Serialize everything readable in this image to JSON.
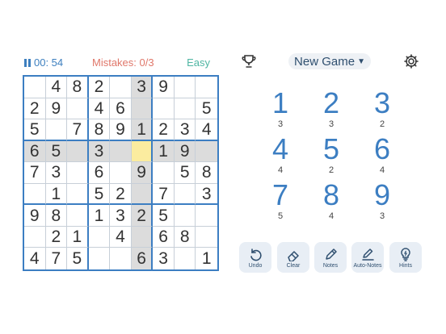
{
  "status": {
    "timer": "00: 54",
    "mistakes": "Mistakes: 0/3",
    "difficulty": "Easy"
  },
  "header": {
    "new_game_label": "New Game"
  },
  "board": {
    "rows": [
      [
        "",
        "4",
        "8",
        "2",
        "",
        "3",
        "9",
        "",
        ""
      ],
      [
        "2",
        "9",
        "",
        "4",
        "6",
        "",
        "",
        "",
        "5"
      ],
      [
        "5",
        "",
        "7",
        "8",
        "9",
        "1",
        "2",
        "3",
        "4"
      ],
      [
        "6",
        "5",
        "",
        "3",
        "",
        "",
        "1",
        "9",
        ""
      ],
      [
        "7",
        "3",
        "",
        "6",
        "",
        "9",
        "",
        "5",
        "8"
      ],
      [
        "",
        "1",
        "",
        "5",
        "2",
        "",
        "7",
        "",
        "3"
      ],
      [
        "9",
        "8",
        "",
        "1",
        "3",
        "2",
        "5",
        "",
        ""
      ],
      [
        "",
        "2",
        "1",
        "",
        "4",
        "",
        "6",
        "8",
        ""
      ],
      [
        "4",
        "7",
        "5",
        "",
        "",
        "6",
        "3",
        "",
        "1"
      ]
    ],
    "selected": {
      "row": 3,
      "col": 5
    }
  },
  "numpad": [
    {
      "digit": "1",
      "remaining": "3"
    },
    {
      "digit": "2",
      "remaining": "3"
    },
    {
      "digit": "3",
      "remaining": "2"
    },
    {
      "digit": "4",
      "remaining": "4"
    },
    {
      "digit": "5",
      "remaining": "2"
    },
    {
      "digit": "6",
      "remaining": "4"
    },
    {
      "digit": "7",
      "remaining": "5"
    },
    {
      "digit": "8",
      "remaining": "4"
    },
    {
      "digit": "9",
      "remaining": "3"
    }
  ],
  "tools": [
    {
      "label": "Undo",
      "icon": "undo-icon"
    },
    {
      "label": "Clear",
      "icon": "eraser-icon"
    },
    {
      "label": "Notes",
      "icon": "pencil-icon"
    },
    {
      "label": "Auto-Notes",
      "icon": "auto-notes-icon"
    },
    {
      "label": "Hints",
      "icon": "lightbulb-icon"
    }
  ],
  "colors": {
    "accent": "#3c7ec2",
    "mistakes": "#e0776a",
    "difficulty": "#4fb6a3",
    "highlight": "#dcdcdc",
    "selected": "#fbec9f"
  }
}
